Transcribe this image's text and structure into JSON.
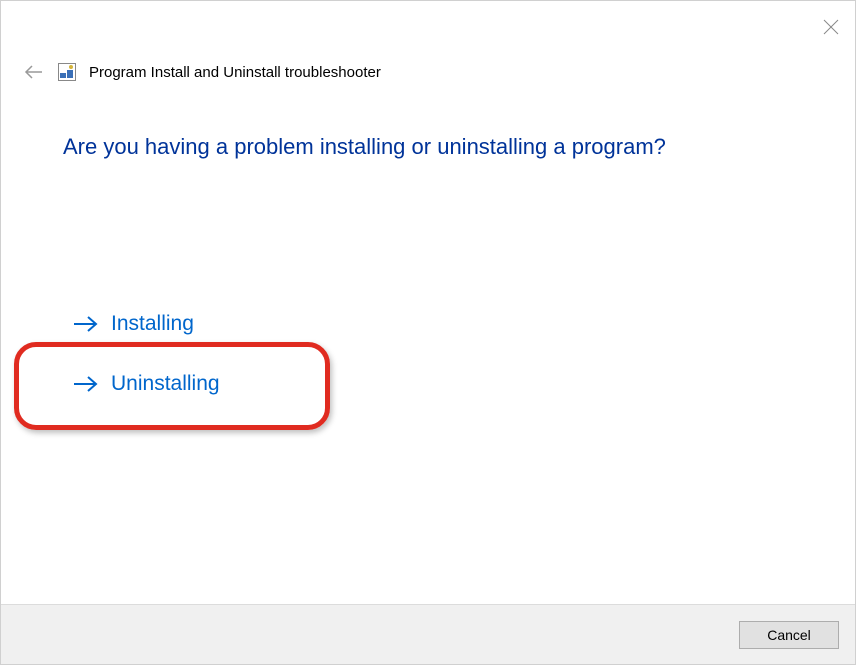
{
  "header": {
    "title": "Program Install and Uninstall troubleshooter"
  },
  "main": {
    "question": "Are you having a problem installing or uninstalling a program?",
    "options": [
      {
        "label": "Installing"
      },
      {
        "label": "Uninstalling"
      }
    ]
  },
  "footer": {
    "cancel_label": "Cancel"
  }
}
